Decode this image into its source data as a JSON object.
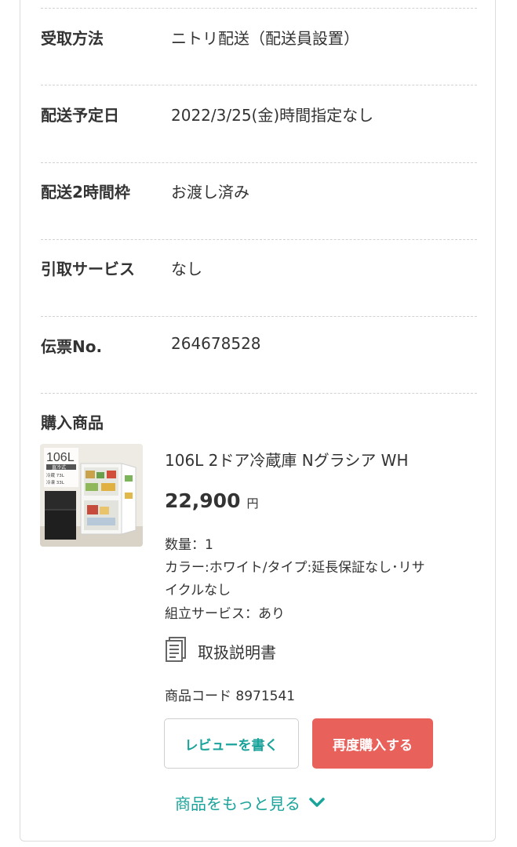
{
  "rows": [
    {
      "label": "受取方法",
      "value": "ニトリ配送（配送員設置）"
    },
    {
      "label": "配送予定日",
      "value": "2022/3/25(金)時間指定なし"
    },
    {
      "label": "配送2時間枠",
      "value": "お渡し済み"
    },
    {
      "label": "引取サービス",
      "value": "なし"
    },
    {
      "label": "伝票No.",
      "value": "264678528"
    }
  ],
  "purchased": {
    "section_title": "購入商品",
    "thumb": {
      "capacity": "106L",
      "type": "直冷式",
      "fridge": "冷蔵 73L",
      "freezer": "冷凍 33L"
    },
    "product_name": "106L 2ドア冷蔵庫 Nグラシア WH",
    "price": "22,900",
    "currency": "円",
    "quantity": "数量：1",
    "option_line1": "カラー:ホワイト/タイプ:延長保証なし･リサ",
    "option_line2": "イクルなし",
    "assembly": "組立サービス：あり",
    "manual_label": "取扱説明書",
    "product_code": "商品コード 8971541"
  },
  "buttons": {
    "review": "レビューを書く",
    "rebuy": "再度購入する"
  },
  "more_link": "商品をもっと見る",
  "colors": {
    "accent": "#1aa39a",
    "rebuy": "#e8615a",
    "text": "#333333"
  }
}
